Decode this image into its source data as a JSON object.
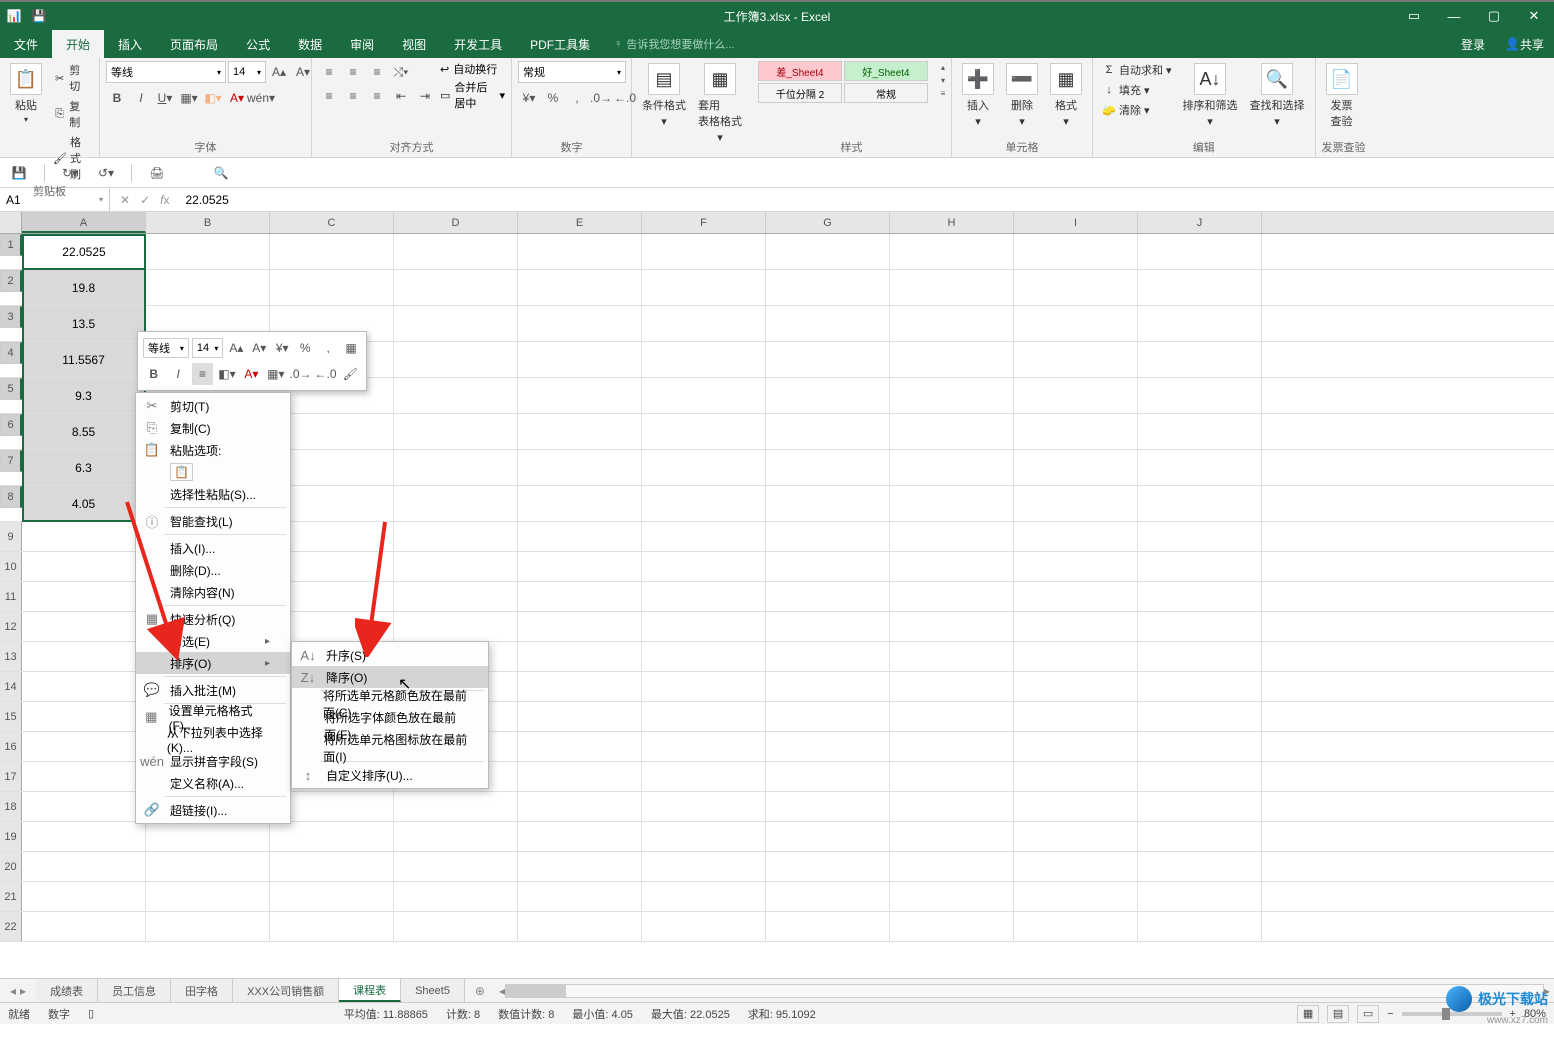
{
  "title": "工作簿3.xlsx - Excel",
  "tabs": [
    "文件",
    "开始",
    "插入",
    "页面布局",
    "公式",
    "数据",
    "审阅",
    "视图",
    "开发工具",
    "PDF工具集"
  ],
  "tell_me": "告诉我您想要做什么...",
  "login": "登录",
  "share": "共享",
  "ribbon": {
    "paste": "粘贴",
    "cut": "剪切",
    "copy": "复制",
    "format_painter": "格式刷",
    "clipboard_label": "剪贴板",
    "font_name": "等线",
    "font_size": "14",
    "font_label": "字体",
    "align_label": "对齐方式",
    "wrap": "自动换行",
    "merge": "合并后居中",
    "number_format": "常规",
    "number_label": "数字",
    "cond_format": "条件格式",
    "as_table": "套用\n表格格式",
    "style_pink": "差_Sheet4",
    "style_green": "好_Sheet4",
    "style_thousand": "千位分隔 2",
    "style_normal": "常规",
    "styles_label": "样式",
    "insert": "插入",
    "delete": "删除",
    "format": "格式",
    "cells_label": "单元格",
    "autosum": "自动求和",
    "fill": "填充",
    "clear": "清除",
    "sort_filter": "排序和筛选",
    "find_select": "查找和选择",
    "edit_label": "编辑",
    "invoice": "发票\n查验",
    "invoice_label": "发票查验"
  },
  "namebox": "A1",
  "formula": "22.0525",
  "columns": [
    "A",
    "B",
    "C",
    "D",
    "E",
    "F",
    "G",
    "H",
    "I",
    "J"
  ],
  "cells_a": [
    "22.0525",
    "19.8",
    "13.5",
    "11.5567",
    "9.3",
    "8.55",
    "6.3",
    "4.05"
  ],
  "mini_toolbar": {
    "font": "等线",
    "size": "14"
  },
  "context_menu": {
    "cut": "剪切(T)",
    "copy": "复制(C)",
    "paste_options": "粘贴选项:",
    "paste_special": "选择性粘贴(S)...",
    "smart_lookup": "智能查找(L)",
    "insert": "插入(I)...",
    "delete": "删除(D)...",
    "clear": "清除内容(N)",
    "quick_analysis": "快速分析(Q)",
    "filter": "筛选(E)",
    "sort": "排序(O)",
    "insert_comment": "插入批注(M)",
    "format_cells": "设置单元格格式(F)...",
    "dropdown": "从下拉列表中选择(K)...",
    "pinyin": "显示拼音字段(S)",
    "define_name": "定义名称(A)...",
    "hyperlink": "超链接(I)..."
  },
  "sort_submenu": {
    "asc": "升序(S)",
    "desc": "降序(O)",
    "color_top": "将所选单元格颜色放在最前面(C)",
    "font_top": "将所选字体颜色放在最前面(F)",
    "icon_top": "将所选单元格图标放在最前面(I)",
    "custom": "自定义排序(U)..."
  },
  "sheet_tabs": [
    "成绩表",
    "员工信息",
    "田字格",
    "XXX公司销售额",
    "课程表",
    "Sheet5"
  ],
  "status": {
    "ready": "就绪",
    "num": "数字",
    "avg": "平均值: 11.88865",
    "count": "计数: 8",
    "num_count": "数值计数: 8",
    "min": "最小值: 4.05",
    "max": "最大值: 22.0525",
    "sum": "求和: 95.1092",
    "zoom": "80%"
  },
  "watermark": "极光下载站",
  "watermark_url": "www.xz7.com"
}
